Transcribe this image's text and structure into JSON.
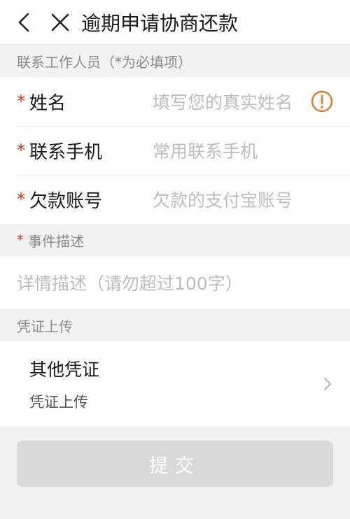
{
  "nav": {
    "title": "逾期申请协商还款",
    "back_icon": "chevron-left-icon",
    "close_icon": "close-icon"
  },
  "contact_section": {
    "label": "联系工作人员（*为必填项）",
    "fields": [
      {
        "required": "*",
        "label": "姓名",
        "placeholder": "填写您的真实姓名",
        "icon": "warning-circle-icon"
      },
      {
        "required": "*",
        "label": "联系手机",
        "placeholder": "常用联系手机"
      },
      {
        "required": "*",
        "label": "欠款账号",
        "placeholder": "欠款的支付宝账号"
      }
    ]
  },
  "description_section": {
    "required": "*",
    "label": "事件描述",
    "placeholder": "详情描述（请勿超过100字）"
  },
  "voucher_section": {
    "label": "凭证上传",
    "item_title": "其他凭证",
    "item_subtitle": "凭证上传",
    "chevron_icon": "chevron-right-icon"
  },
  "submit": {
    "label": "提交"
  },
  "colors": {
    "accent_required": "#d0351f",
    "warning_icon": "#e07b2a",
    "disabled_button": "#d9d9d9"
  }
}
